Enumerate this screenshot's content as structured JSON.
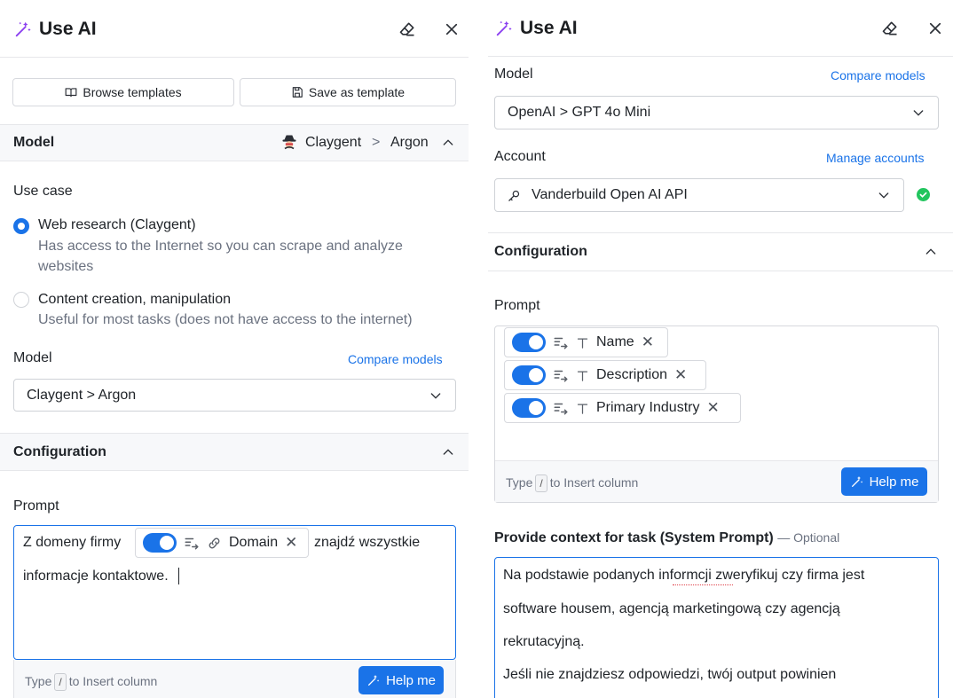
{
  "left": {
    "header": {
      "title": "Use AI"
    },
    "toolbar": {
      "browse_label": "Browse templates",
      "save_label": "Save as template"
    },
    "model_section": {
      "title": "Model",
      "provider": "Claygent",
      "separator": ">",
      "model": "Argon"
    },
    "use_case": {
      "title": "Use case",
      "options": [
        {
          "label": "Web research (Claygent)",
          "description_line1": "Has access to the Internet so you can scrape and analyze",
          "description_line2": "websites",
          "selected": true
        },
        {
          "label": "Content creation, manipulation",
          "description_line1": "Useful for most tasks (does not have access to the internet)",
          "selected": false
        }
      ]
    },
    "model_select": {
      "label": "Model",
      "compare_link": "Compare models",
      "value": "Claygent > Argon"
    },
    "configuration": {
      "title": "Configuration"
    },
    "prompt": {
      "label": "Prompt",
      "text_before": "Z domeny firmy",
      "chip_label": "Domain",
      "text_after": "znajdź wszystkie",
      "text_line2": "informacje kontaktowe.",
      "hint_before": "Type",
      "hint_key": "/",
      "hint_after": "to Insert column",
      "help_label": "Help me"
    }
  },
  "right": {
    "header": {
      "title": "Use AI"
    },
    "model_select": {
      "label": "Model",
      "compare_link": "Compare models",
      "value": "OpenAI > GPT 4o Mini"
    },
    "account": {
      "label": "Account",
      "manage_link": "Manage accounts",
      "value": "Vanderbuild Open AI API",
      "status_color": "#22c55e"
    },
    "configuration": {
      "title": "Configuration"
    },
    "prompt": {
      "label": "Prompt",
      "chips": [
        {
          "label": "Name"
        },
        {
          "label": "Description"
        },
        {
          "label": "Primary Industry"
        }
      ],
      "hint_before": "Type",
      "hint_key": "/",
      "hint_after": "to Insert column",
      "help_label": "Help me"
    },
    "system_prompt": {
      "label": "Provide context for task (System Prompt)",
      "optional": "— Optional",
      "lines": [
        "Na podstawie podanych informcji zweryfikuj czy firma jest",
        "software housem, agencją marketingową czy agencją",
        "rekrutacyjną.",
        "Jeśli nie znajdziesz odpowiedzi, twój output powinien"
      ]
    }
  },
  "colors": {
    "accent": "#1a73e8",
    "wand": "#8b3ff0",
    "status_ok": "#22c55e"
  }
}
